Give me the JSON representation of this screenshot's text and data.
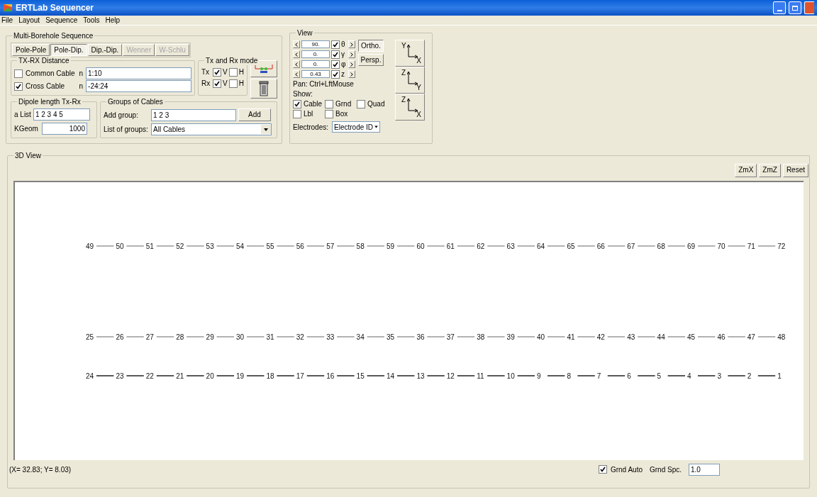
{
  "window": {
    "title": "ERTLab Sequencer"
  },
  "menu": [
    "File",
    "Layout",
    "Sequence",
    "Tools",
    "Help"
  ],
  "sequence": {
    "title": "Multi-Borehole Sequence",
    "types": [
      {
        "label": "Pole-Pole",
        "selected": false,
        "disabled": false
      },
      {
        "label": "Pole-Dip.",
        "selected": true,
        "disabled": false
      },
      {
        "label": "Dip.-Dip.",
        "selected": false,
        "disabled": false
      },
      {
        "label": "Wenner",
        "selected": false,
        "disabled": true
      },
      {
        "label": "W-Schlu",
        "selected": false,
        "disabled": true
      }
    ],
    "distance": {
      "title": "TX-RX Distance",
      "rows": [
        {
          "label": "Common Cable",
          "checked": false,
          "n_label": "n",
          "value": "1:10"
        },
        {
          "label": "Cross Cable",
          "checked": true,
          "n_label": "n",
          "value": "-24:24"
        }
      ]
    },
    "mode": {
      "title": "Tx and Rx mode",
      "rows": [
        {
          "label": "Tx",
          "v_label": "V",
          "v": true,
          "h_label": "H",
          "h": false
        },
        {
          "label": "Rx",
          "v_label": "V",
          "v": true,
          "h_label": "H",
          "h": false
        }
      ]
    },
    "dipole": {
      "title": "Dipole length Tx-Rx",
      "list_label": "a List",
      "list_value": "1 2 3 4 5",
      "kgeom_label": "KGeom",
      "kgeom_value": "1000"
    },
    "groups": {
      "title": "Groups of Cables",
      "add_label": "Add group:",
      "add_value": "1 2 3",
      "add_button": "Add",
      "list_label": "List of groups:",
      "list_value": "All Cables"
    }
  },
  "view": {
    "title": "View",
    "angles": [
      {
        "value": "90.",
        "checked": true,
        "symbol": "θ"
      },
      {
        "value": "0.",
        "checked": true,
        "symbol": "γ"
      },
      {
        "value": "0.",
        "checked": true,
        "symbol": "φ"
      },
      {
        "value": "0.43",
        "checked": true,
        "symbol": "z"
      }
    ],
    "projections": [
      {
        "label": "Ortho.",
        "selected": true
      },
      {
        "label": "Persp.",
        "selected": false
      }
    ],
    "axes": [
      {
        "up": "Y",
        "right": "X"
      },
      {
        "up": "Z",
        "right": "Y"
      },
      {
        "up": "Z",
        "right": "X"
      }
    ],
    "pan_hint": "Pan: Ctrl+LftMouse",
    "show_label": "Show:",
    "show": [
      [
        {
          "label": "Cable",
          "checked": true
        },
        {
          "label": "Grnd",
          "checked": false
        },
        {
          "label": "Quad",
          "checked": false
        }
      ],
      [
        {
          "label": "Lbl",
          "checked": false
        },
        {
          "label": "Box",
          "checked": false
        }
      ]
    ],
    "electrodes_label": "Electrodes:",
    "electrodes_value": "Electrode ID"
  },
  "view3d": {
    "title": "3D View",
    "buttons": [
      "ZmX",
      "ZmZ",
      "Reset"
    ],
    "cables": [
      {
        "labels": [
          "49",
          "50",
          "51",
          "52",
          "53",
          "54",
          "55",
          "56",
          "57",
          "58",
          "59",
          "60",
          "61",
          "62",
          "63",
          "64",
          "65",
          "66",
          "67",
          "68",
          "69",
          "70",
          "71",
          "72"
        ]
      },
      {
        "labels": [
          "25",
          "26",
          "27",
          "28",
          "29",
          "30",
          "31",
          "32",
          "33",
          "34",
          "35",
          "36",
          "37",
          "38",
          "39",
          "40",
          "41",
          "42",
          "43",
          "44",
          "45",
          "46",
          "47",
          "48"
        ]
      },
      {
        "labels": [
          "24",
          "23",
          "22",
          "21",
          "20",
          "19",
          "18",
          "17",
          "16",
          "15",
          "14",
          "13",
          "12",
          "11",
          "10",
          "9",
          "8",
          "7",
          "6",
          "5",
          "4",
          "3",
          "2",
          "1"
        ]
      }
    ]
  },
  "status": {
    "coords": "(X= 32.83; Y= 8.03)",
    "grid_auto": {
      "label": "Grnd Auto",
      "checked": true
    },
    "grid_spacing_label": "Grnd Spc.",
    "grid_spacing": "1.0"
  }
}
